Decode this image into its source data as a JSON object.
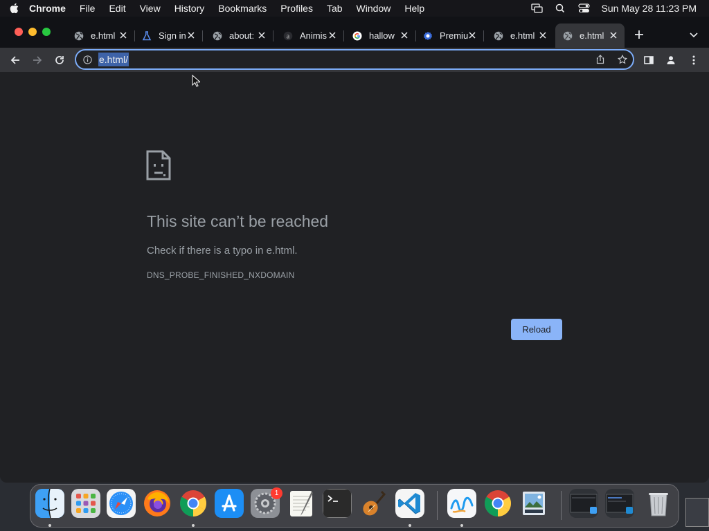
{
  "menubar": {
    "app_name": "Chrome",
    "items": [
      "File",
      "Edit",
      "View",
      "History",
      "Bookmarks",
      "Profiles",
      "Tab",
      "Window",
      "Help"
    ],
    "clock": "Sun May 28  11:23 PM"
  },
  "tabs": [
    {
      "title": "e.html",
      "favicon": "globe-icon"
    },
    {
      "title": "Sign in",
      "favicon": "flask-icon"
    },
    {
      "title": "about:",
      "favicon": "globe-icon"
    },
    {
      "title": "Animis",
      "favicon": "a-letter-icon"
    },
    {
      "title": "hallow",
      "favicon": "google-icon"
    },
    {
      "title": "Premiu",
      "favicon": "badge-icon"
    },
    {
      "title": "e.html",
      "favicon": "globe-icon"
    },
    {
      "title": "e.html",
      "favicon": "globe-icon",
      "active": true
    }
  ],
  "omnibox": {
    "url": "e.html/"
  },
  "error_page": {
    "heading": "This site can’t be reached",
    "subtext": "Check if there is a typo in e.html.",
    "code": "DNS_PROBE_FINISHED_NXDOMAIN",
    "reload_label": "Reload"
  },
  "dock": {
    "apps": [
      "Finder",
      "Launchpad",
      "Safari",
      "Firefox",
      "Google Chrome",
      "App Store",
      "System Preferences",
      "TextEdit",
      "Terminal",
      "GarageBand",
      "Visual Studio Code",
      "Freeform",
      "Google Chrome",
      "Preview"
    ],
    "system_preferences_badge": "1"
  },
  "colors": {
    "accent": "#8ab4f8",
    "omnibox_border": "#7cacf8",
    "page_bg": "#202124",
    "toolbar_bg": "#35363a"
  }
}
